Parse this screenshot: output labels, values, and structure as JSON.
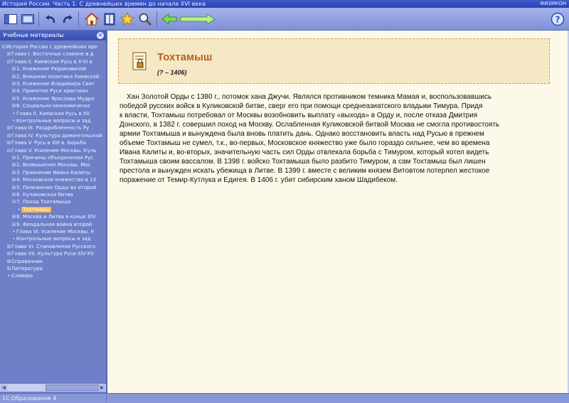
{
  "window": {
    "title": "История России. Часть 1. С древнейших времен до начала XVI века",
    "brand": "ФИЗИКОН"
  },
  "toolbar": {
    "buttons": [
      {
        "name": "toggle-sidebar",
        "icon": "panel-icon"
      },
      {
        "name": "fullscreen",
        "icon": "screen-icon"
      },
      {
        "name": "undo",
        "icon": "undo-icon"
      },
      {
        "name": "redo",
        "icon": "redo-icon"
      },
      {
        "name": "home",
        "icon": "home-icon"
      },
      {
        "name": "book",
        "icon": "book-icon"
      },
      {
        "name": "favorites",
        "icon": "star-icon"
      },
      {
        "name": "search",
        "icon": "magnifier-icon"
      },
      {
        "name": "back",
        "icon": "arrow-left-icon"
      },
      {
        "name": "forward",
        "icon": "arrow-right-icon"
      },
      {
        "name": "help",
        "icon": "help-icon"
      }
    ],
    "help_label": "?"
  },
  "sidebar": {
    "title": "Учебные материалы",
    "close_label": "✕",
    "tree": [
      {
        "mark": "⊟",
        "label": "История России с древнейших вре"
      },
      {
        "mark": "⊞",
        "label": "Глава I. Восточные славяне в д"
      },
      {
        "mark": "⊟",
        "label": "Глава II. Киевская Русь в X-XI в"
      },
      {
        "mark": "⊞",
        "label": "1. Княжение Рюриковичей"
      },
      {
        "mark": "⊞",
        "label": "2. Внешняя политика Киевской"
      },
      {
        "mark": "⊞",
        "label": "3. Княжение Владимира Свят"
      },
      {
        "mark": "⊞",
        "label": "4. Принятие Руси христиан"
      },
      {
        "mark": "⊞",
        "label": "5. Княжение Ярослава Мудро"
      },
      {
        "mark": "⊞",
        "label": "6. Социально-экономическо"
      },
      {
        "mark": "•",
        "label": "Глава II. Киевская Русь в XII"
      },
      {
        "mark": "•",
        "label": "Контрольные вопросы и зад"
      },
      {
        "mark": "⊞",
        "label": "Глава III. Раздробленность Ру"
      },
      {
        "mark": "⊞",
        "label": "Глава IV. Культура домонгольской"
      },
      {
        "mark": "⊞",
        "label": "Глава V. Русь в XIII в. Борьба"
      },
      {
        "mark": "⊟",
        "label": "Глава V. Усиление Москвы. Куль"
      },
      {
        "mark": "⊞",
        "label": "1. Причины объединения Рус"
      },
      {
        "mark": "⊞",
        "label": "2. Возвышение Москвы. Мос"
      },
      {
        "mark": "⊞",
        "label": "3. Правление Ивана Калиты"
      },
      {
        "mark": "⊞",
        "label": "4. Московское княжество в 13"
      },
      {
        "mark": "⊞",
        "label": "5. Положение Орды во второй"
      },
      {
        "mark": "⊞",
        "label": "6. Куликовская битва"
      },
      {
        "mark": "⊟",
        "label": "7. Поход Тохтамыша"
      },
      {
        "mark": "•",
        "label": "Тохтамыш"
      },
      {
        "mark": "⊞",
        "label": "8. Москва и Литва в конце XIV"
      },
      {
        "mark": "⊞",
        "label": "9. Феодальная война второй"
      },
      {
        "mark": "•",
        "label": "Глава VI. Усиление Москвы. К"
      },
      {
        "mark": "•",
        "label": "Контрольные вопросы и зад"
      },
      {
        "mark": "⊞",
        "label": "Глава VI. Становление Русского"
      },
      {
        "mark": "⊞",
        "label": "Глава VII. Культура Руси XIV-XV"
      },
      {
        "mark": "⊞",
        "label": "Справочник"
      },
      {
        "mark": "⊞",
        "label": "Литература"
      },
      {
        "mark": "•",
        "label": "Словарь"
      }
    ],
    "selected_index": 22
  },
  "article": {
    "title": "Тохтамыш",
    "dates": "(? – 1406)",
    "lines": [
      "Хан Золотой Орды с 1380 г., потомок хана Джучи. Являлся противником темника Мамая и, воспользовавшись",
      "победой русских войск в Куликовской битве, сверг его при помощи среднеазиатского владыки Тимура. Придя",
      "к власти, Тохтамыш потребовал от Москвы возобновить выплату «выхода» в Орду и, после отказа Дмитрия",
      "Донского, в 1382 г. совершил поход на Москву. Ослабленная Куликовской битвой Москва не смогла противостоять",
      "армии Тохтамыша и вынуждена была вновь платить дань. Однако восстановить власть над Русью в прежнем",
      "объеме Тохтамыш не сумел, т.к., во-первых, Московское княжество уже было гораздо сильнее, чем во времена",
      "Ивана Калиты и, во-вторых, значительную часть сил Орды отвлекала борьба с Тимуром, который хотел видеть",
      "Тохтамыша своим вассалом. В 1398 г. войско Тохтамыша было разбито Тимуром, а сам Тохтамыш был лишен",
      "престола и вынужден искать убежища в Литве. В 1399 г. вместе с великим князем Витовтом потерпел жестокое",
      "поражение от Темир-Кутлука и Едигея. В 1406 г. убит сибирским ханом Шадибеком."
    ]
  },
  "statusbar": {
    "text": "1С:Образование 4"
  },
  "colors": {
    "accent_orange": "#b6621d",
    "selection": "#ffb443",
    "sidebar_bg": "#6d80c8",
    "content_bg": "#fdf9e9"
  }
}
